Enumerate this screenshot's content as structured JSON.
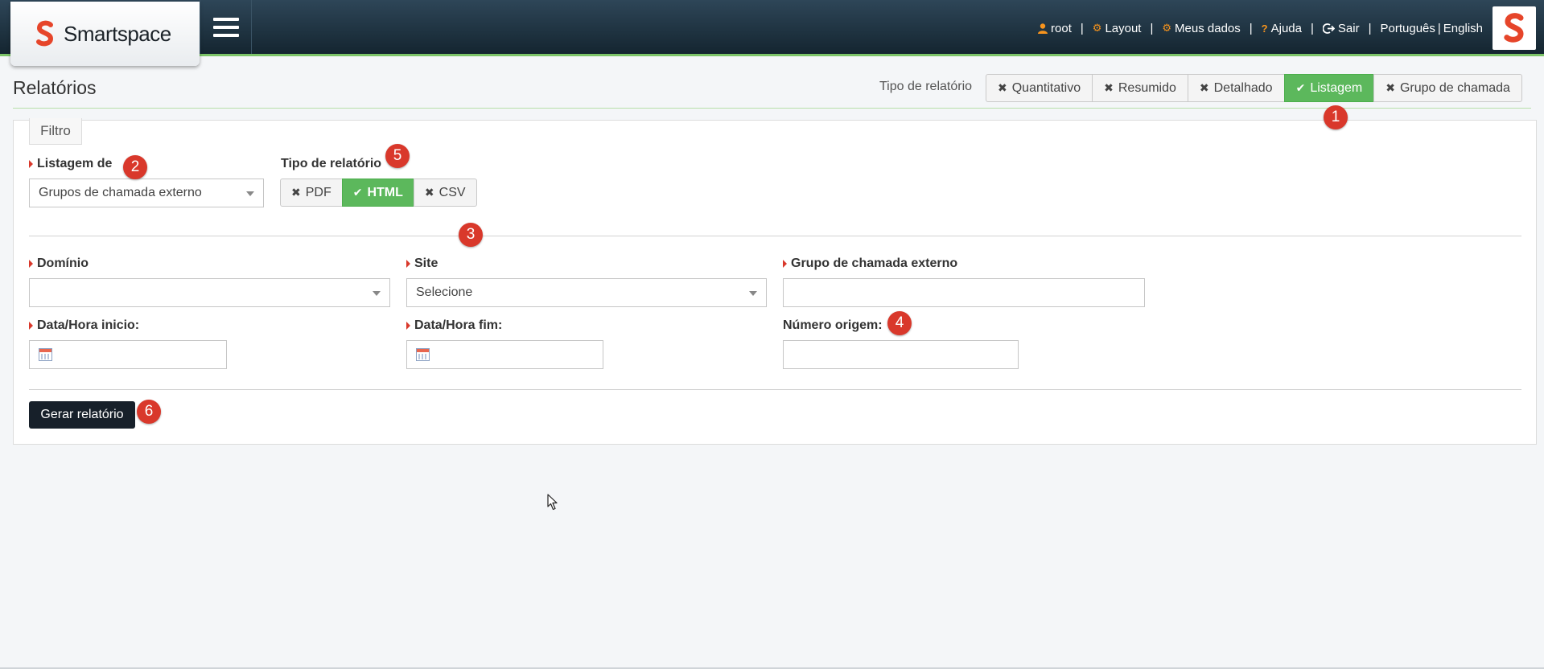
{
  "brand": {
    "name": "Smartspace",
    "accent": "#e6452a"
  },
  "topnav": [
    {
      "label": "root",
      "icon": "user-icon"
    },
    {
      "label": "Layout",
      "icon": "cogs-icon"
    },
    {
      "label": "Meus dados",
      "icon": "gear-icon"
    },
    {
      "label": "Ajuda",
      "icon": "question-icon"
    },
    {
      "label": "Sair",
      "icon": "sign-out-icon"
    }
  ],
  "languages": {
    "pt": "Português",
    "sep": "|",
    "en": "English"
  },
  "page": {
    "title": "Relatórios"
  },
  "report_type": {
    "label": "Tipo de relatório",
    "options": [
      {
        "label": "Quantitativo",
        "active": false
      },
      {
        "label": "Resumido",
        "active": false
      },
      {
        "label": "Detalhado",
        "active": false
      },
      {
        "label": "Listagem",
        "active": true
      },
      {
        "label": "Grupo de chamada",
        "active": false
      }
    ]
  },
  "filter": {
    "tab_label": "Filtro",
    "listagem": {
      "label": "Listagem de",
      "value": "Grupos de chamada externo"
    },
    "format": {
      "label": "Tipo de relatório",
      "options": [
        {
          "label": "PDF",
          "active": false
        },
        {
          "label": "HTML",
          "active": true
        },
        {
          "label": "CSV",
          "active": false
        }
      ]
    },
    "dominio": {
      "label": "Domínio",
      "value": ""
    },
    "site": {
      "label": "Site",
      "value": "Selecione"
    },
    "grupo": {
      "label": "Grupo de chamada externo",
      "value": ""
    },
    "data_inicio": {
      "label": "Data/Hora inicio:",
      "value": ""
    },
    "data_fim": {
      "label": "Data/Hora fim:",
      "value": ""
    },
    "numero_origem": {
      "label": "Número origem:",
      "value": ""
    },
    "submit_label": "Gerar relatório"
  },
  "annotations": [
    "1",
    "2",
    "3",
    "4",
    "5",
    "6"
  ],
  "colors": {
    "active_green": "#5cb85c",
    "badge_red": "#d9382b",
    "topbar_dark": "#142530"
  }
}
